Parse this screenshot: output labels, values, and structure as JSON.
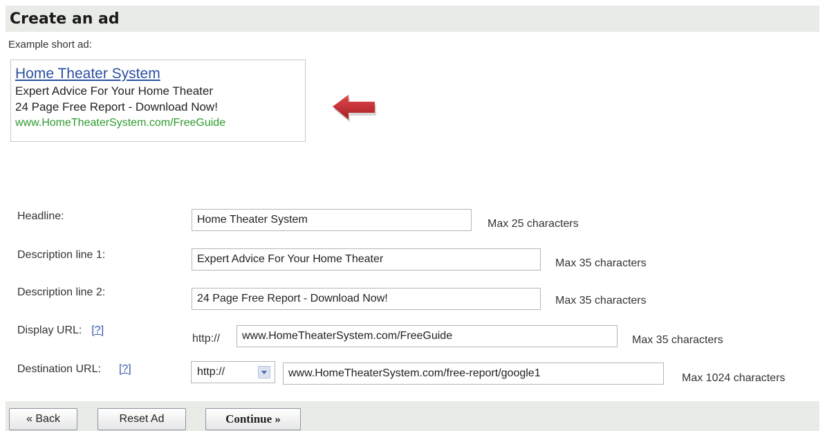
{
  "header": {
    "title": "Create an ad"
  },
  "example": {
    "label": "Example short ad:",
    "headline": "Home Theater System",
    "line1": "Expert Advice For Your Home Theater",
    "line2": "24 Page Free Report - Download Now!",
    "url": "www.HomeTheaterSystem.com/FreeGuide"
  },
  "form": {
    "headline": {
      "label": "Headline:",
      "value": "Home Theater System",
      "hint": "Max 25 characters"
    },
    "desc1": {
      "label": "Description line 1:",
      "value": "Expert Advice For Your Home Theater",
      "hint": "Max 35 characters"
    },
    "desc2": {
      "label": "Description line 2:",
      "value": "24 Page Free Report - Download Now!",
      "hint": "Max 35 characters"
    },
    "display_url": {
      "label": "Display URL:",
      "help": "[?]",
      "prefix": "http://",
      "value": "www.HomeTheaterSystem.com/FreeGuide",
      "hint": "Max 35 characters"
    },
    "destination_url": {
      "label": "Destination URL:",
      "help": "[?]",
      "protocol": "http://",
      "value": "www.HomeTheaterSystem.com/free-report/google1",
      "hint": "Max 1024 characters"
    }
  },
  "buttons": {
    "back": "« Back",
    "reset": "Reset Ad",
    "continue": "Continue »"
  },
  "colors": {
    "ad_headline": "#2a4fa0",
    "ad_url": "#2e9a2e",
    "arrow": "#c0272d",
    "bar_background": "#e9ece6"
  },
  "icons": {
    "pointer": "left-arrow-icon"
  }
}
